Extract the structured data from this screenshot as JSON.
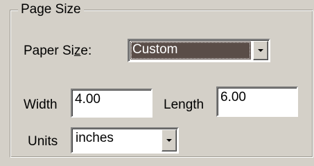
{
  "group": {
    "title": "Page Size"
  },
  "paper_size": {
    "label_pre": "Paper Si",
    "label_accel": "z",
    "label_post": "e:",
    "value": "Custom"
  },
  "width": {
    "label": "Width",
    "value": "4.00"
  },
  "length": {
    "label": "Length",
    "value": "6.00"
  },
  "units": {
    "label": "Units",
    "value": "inches"
  },
  "icons": {
    "dropdown": "chevron-down-icon"
  },
  "colors": {
    "background": "#d4d0c8",
    "selection": "#5a4d48"
  }
}
